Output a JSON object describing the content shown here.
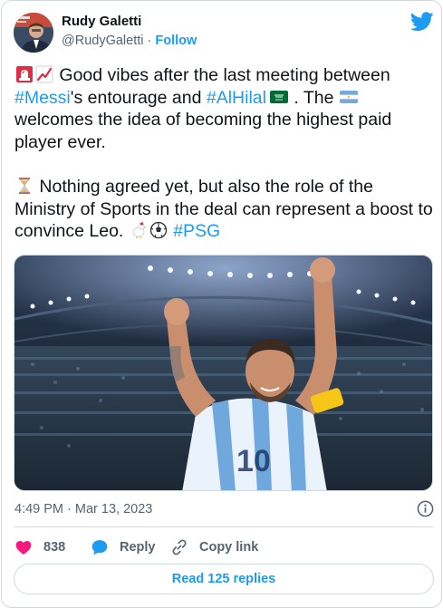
{
  "author": {
    "name": "Rudy Galetti",
    "handle": "@RudyGaletti",
    "separator": " · ",
    "follow_label": "Follow"
  },
  "tweet": {
    "line1_text": " Good vibes after the last meeting between ",
    "hashtag_messi": "#Messi",
    "line1b_text": "'s entourage and ",
    "hashtag_alhilal": "#AlHilal",
    "line1c_text": " . The ",
    "line1d_text": " welcomes the idea of becoming the highest paid player ever.",
    "para2_text": " Nothing agreed yet, but also the role of the Ministry of Sports in the deal can represent a boost to convince Leo. ",
    "hashtag_psg": "#PSG",
    "emoji_names": [
      "siren-emoji",
      "chart-increasing-emoji",
      "saudi-arabia-flag-emoji",
      "argentina-flag-emoji",
      "hourglass-emoji",
      "rooster-emoji",
      "soccer-ball-emoji"
    ]
  },
  "media": {
    "icon": "photo-of-player-celebrating"
  },
  "meta": {
    "timestamp": "4:49 PM · Mar 13, 2023"
  },
  "actions": {
    "like_count": "838",
    "reply_label": "Reply",
    "copy_label": "Copy link"
  },
  "replies_button": "Read 125 replies",
  "colors": {
    "accent": "#1d9bf0",
    "like": "#f91880",
    "text": "#0f1419",
    "secondary": "#536471",
    "border": "#cfd9de"
  }
}
